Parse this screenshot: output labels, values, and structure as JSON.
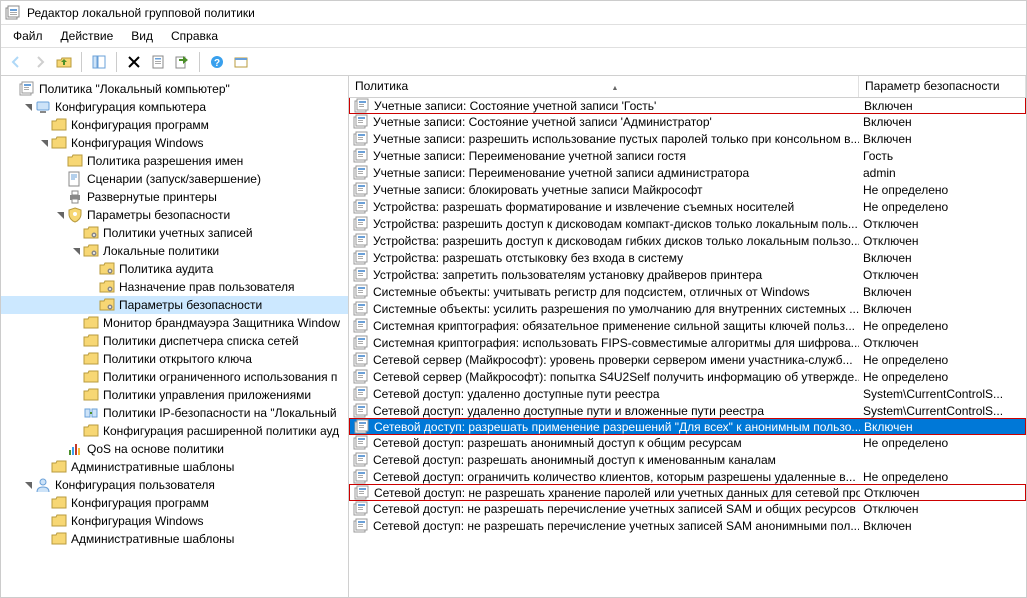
{
  "window": {
    "title": "Редактор локальной групповой политики"
  },
  "menubar": {
    "items": [
      "Файл",
      "Действие",
      "Вид",
      "Справка"
    ]
  },
  "toolbar_tips": {
    "back": "Назад",
    "forward": "Вперед",
    "up": "Вверх",
    "show_hide_tree": "Показать/скрыть дерево консоли",
    "delete": "Удалить",
    "properties": "Свойства",
    "export": "Экспортировать список",
    "help": "Справка",
    "action1": "",
    "action2": ""
  },
  "tree": {
    "root": {
      "label": "Политика \"Локальный компьютер\"",
      "children": [
        {
          "label": "Конфигурация компьютера",
          "expanded": true,
          "icon": "computer",
          "children": [
            {
              "label": "Конфигурация программ",
              "icon": "folder"
            },
            {
              "label": "Конфигурация Windows",
              "icon": "folder",
              "expanded": true,
              "children": [
                {
                  "label": "Политика разрешения имен",
                  "icon": "folder"
                },
                {
                  "label": "Сценарии (запуск/завершение)",
                  "icon": "script"
                },
                {
                  "label": "Развернутые принтеры",
                  "icon": "printer"
                },
                {
                  "label": "Параметры безопасности",
                  "icon": "shield",
                  "expanded": true,
                  "children": [
                    {
                      "label": "Политики учетных записей",
                      "icon": "folder-gear"
                    },
                    {
                      "label": "Локальные политики",
                      "icon": "folder-gear",
                      "expanded": true,
                      "children": [
                        {
                          "label": "Политика аудита",
                          "icon": "folder-gear"
                        },
                        {
                          "label": "Назначение прав пользователя",
                          "icon": "folder-gear"
                        },
                        {
                          "label": "Параметры безопасности",
                          "icon": "folder-gear",
                          "selected": true
                        }
                      ]
                    },
                    {
                      "label": "Монитор брандмауэра Защитника Window",
                      "icon": "folder"
                    },
                    {
                      "label": "Политики диспетчера списка сетей",
                      "icon": "folder"
                    },
                    {
                      "label": "Политики открытого ключа",
                      "icon": "folder"
                    },
                    {
                      "label": "Политики ограниченного использования п",
                      "icon": "folder"
                    },
                    {
                      "label": "Политики управления приложениями",
                      "icon": "folder"
                    },
                    {
                      "label": "Политики IP-безопасности на \"Локальный",
                      "icon": "ipsec"
                    },
                    {
                      "label": "Конфигурация расширенной политики ауд",
                      "icon": "folder"
                    }
                  ]
                },
                {
                  "label": "QoS на основе политики",
                  "icon": "qos"
                }
              ]
            },
            {
              "label": "Административные шаблоны",
              "icon": "folder"
            }
          ]
        },
        {
          "label": "Конфигурация пользователя",
          "expanded": true,
          "icon": "user",
          "children": [
            {
              "label": "Конфигурация программ",
              "icon": "folder"
            },
            {
              "label": "Конфигурация Windows",
              "icon": "folder"
            },
            {
              "label": "Административные шаблоны",
              "icon": "folder"
            }
          ]
        }
      ]
    }
  },
  "list": {
    "columns": {
      "policy": "Политика",
      "param": "Параметр безопасности"
    },
    "sort": {
      "column": "policy",
      "dir": "asc"
    },
    "rows": [
      {
        "label": "Учетные записи: Состояние учетной записи 'Гость'",
        "value": "Включен",
        "boxed": true
      },
      {
        "label": "Учетные записи: Состояние учетной записи 'Администратор'",
        "value": "Включен"
      },
      {
        "label": "Учетные записи: разрешить использование пустых паролей только при консольном в...",
        "value": "Включен"
      },
      {
        "label": "Учетные записи: Переименование учетной записи гостя",
        "value": "Гость"
      },
      {
        "label": "Учетные записи: Переименование учетной записи администратора",
        "value": "admin"
      },
      {
        "label": "Учетные записи: блокировать учетные записи Майкрософт",
        "value": "Не определено"
      },
      {
        "label": "Устройства: разрешать форматирование и извлечение съемных носителей",
        "value": "Не определено"
      },
      {
        "label": "Устройства: разрешить доступ к дисководам компакт-дисков только локальным поль...",
        "value": "Отключен"
      },
      {
        "label": "Устройства: разрешить доступ к дисководам гибких дисков только локальным пользо...",
        "value": "Отключен"
      },
      {
        "label": "Устройства: разрешать отстыковку без входа в систему",
        "value": "Включен"
      },
      {
        "label": "Устройства: запретить пользователям установку драйверов принтера",
        "value": "Отключен"
      },
      {
        "label": "Системные объекты: учитывать регистр для подсистем, отличных от Windows",
        "value": "Включен"
      },
      {
        "label": "Системные объекты: усилить разрешения по умолчанию для внутренних системных ...",
        "value": "Включен"
      },
      {
        "label": "Системная криптография: обязательное применение сильной защиты ключей польз...",
        "value": "Не определено"
      },
      {
        "label": "Системная криптография: использовать FIPS-совместимые алгоритмы для шифрова...",
        "value": "Отключен"
      },
      {
        "label": "Сетевой сервер (Майкрософт): уровень проверки сервером имени участника-служб...",
        "value": "Не определено"
      },
      {
        "label": "Сетевой сервер (Майкрософт): попытка S4U2Self получить информацию об утвержде...",
        "value": "Не определено"
      },
      {
        "label": "Сетевой доступ: удаленно доступные пути реестра",
        "value": "System\\CurrentControlS..."
      },
      {
        "label": "Сетевой доступ: удаленно доступные пути и вложенные пути реестра",
        "value": "System\\CurrentControlS..."
      },
      {
        "label": "Сетевой доступ: разрешать применение разрешений \"Для всех\" к анонимным пользо...",
        "value": "Включен",
        "selected": true,
        "boxed": true
      },
      {
        "label": "Сетевой доступ: разрешать анонимный доступ к общим ресурсам",
        "value": "Не определено"
      },
      {
        "label": "Сетевой доступ: разрешать анонимный доступ к именованным каналам",
        "value": ""
      },
      {
        "label": "Сетевой доступ: ограничить количество клиентов, которым разрешены удаленные в...",
        "value": "Не определено"
      },
      {
        "label": "Сетевой доступ: не разрешать хранение паролей или учетных данных для сетевой про...",
        "value": "Отключен",
        "boxed": true
      },
      {
        "label": "Сетевой доступ: не разрешать перечисление учетных записей SAM и общих ресурсов ...",
        "value": "Отключен"
      },
      {
        "label": "Сетевой доступ: не разрешать перечисление учетных записей SAM анонимными пол...",
        "value": "Включен"
      }
    ]
  }
}
